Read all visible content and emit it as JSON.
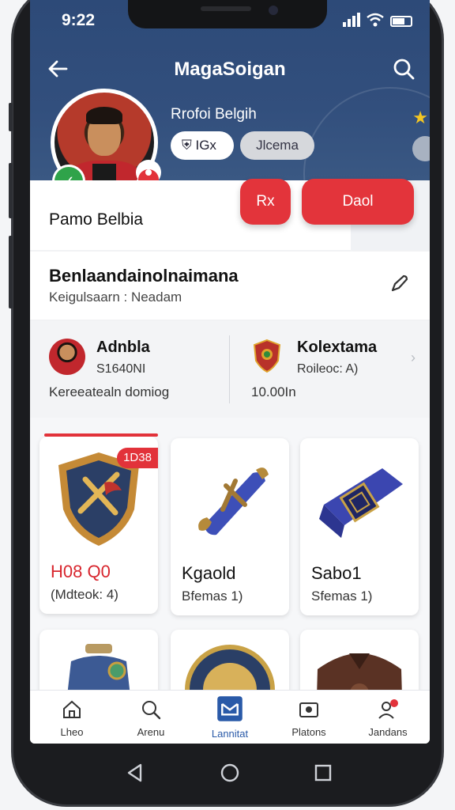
{
  "status_bar": {
    "time": "9:22"
  },
  "app_bar": {
    "title": "MagaSoigan"
  },
  "profile": {
    "name": "Rrofoi Belgih",
    "chip_primary": "IGx",
    "chip_secondary": "Jlcema",
    "display_name": "Pamo Belbia",
    "btn_small": "Rx",
    "btn_large": "Daol"
  },
  "section": {
    "title": "Benlaandainolnaimana",
    "subtitle": "Keigulsaarn : Neadam"
  },
  "stats": {
    "left": {
      "name": "Adnbla",
      "sub": "S1640NI",
      "foot": "Kereeatealn  domiog"
    },
    "right": {
      "name": "Kolextama",
      "sub": "Roileoc: A)",
      "foot": "10.00In"
    }
  },
  "cards": [
    {
      "tag": "1D38",
      "name": "H08 Q0",
      "sub": "(Mdteok: 4)",
      "name_color": "#d8262e"
    },
    {
      "name": "Kgaold",
      "sub": "Bfemas 1)"
    },
    {
      "name": "Sabo1",
      "sub": "Sfemas 1)"
    }
  ],
  "nav": [
    {
      "label": "Lheo",
      "icon": "home-icon"
    },
    {
      "label": "Arenu",
      "icon": "search-icon"
    },
    {
      "label": "Lannitat",
      "icon": "collection-icon",
      "active": true
    },
    {
      "label": "Platons",
      "icon": "photo-icon"
    },
    {
      "label": "Jandans",
      "icon": "person-icon"
    }
  ],
  "colors": {
    "header": "#2d4a78",
    "accent_red": "#e3343b",
    "nav_active": "#2a5aa8"
  }
}
